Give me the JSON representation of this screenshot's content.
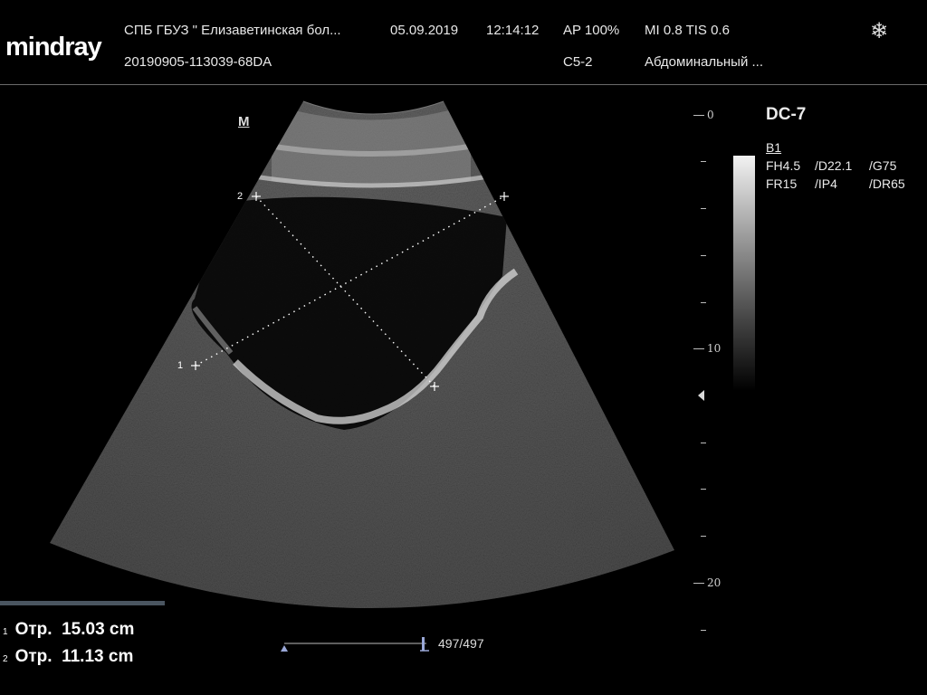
{
  "header": {
    "logo": "mindray",
    "hospital": "СПБ  ГБУЗ \" Елизаветинская бол...",
    "date": "05.09.2019",
    "time": "12:14:12",
    "acoustic_power": "AP  100%",
    "mi_tis": "MI 0.8 TIS 0.6",
    "exam_id": "20190905-113039-68DA",
    "probe_model": "C5-2",
    "exam_type": "Абдоминальный ..."
  },
  "image": {
    "mode_tag": "M",
    "marker_1": "1",
    "marker_2": "2"
  },
  "depth_scale": {
    "labels": [
      "0",
      "10",
      "20"
    ]
  },
  "params": {
    "probe": "DC-7",
    "mode": "B1",
    "rows": [
      [
        "FH4.5",
        "/D22.1",
        "/G75"
      ],
      [
        "FR15",
        "/IP4",
        "/DR65"
      ]
    ]
  },
  "measurements": [
    {
      "index": "1",
      "label": "Отр.",
      "value": "15.03 cm"
    },
    {
      "index": "2",
      "label": "Отр.",
      "value": "11.13 cm"
    }
  ],
  "cine": {
    "frame": "497/497"
  }
}
